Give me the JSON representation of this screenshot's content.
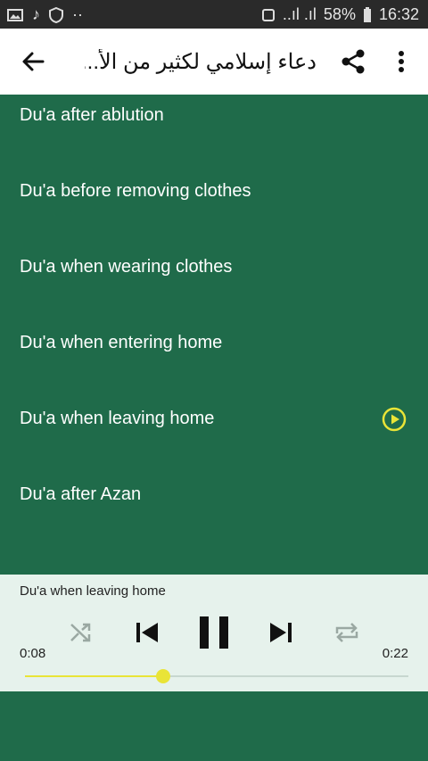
{
  "status_bar": {
    "battery": "58%",
    "time": "16:32",
    "signal": "..ıl .ıl"
  },
  "app_bar": {
    "title": "دعاء إسلامي لكثير من الأ..."
  },
  "list": {
    "items": [
      {
        "label": "Du'a after ablution",
        "playing": false
      },
      {
        "label": "Du'a before removing clothes",
        "playing": false
      },
      {
        "label": "Du'a when wearing clothes",
        "playing": false
      },
      {
        "label": "Du'a when entering home",
        "playing": false
      },
      {
        "label": "Du'a when leaving home",
        "playing": true
      },
      {
        "label": "Du'a after Azan",
        "playing": false
      }
    ]
  },
  "player": {
    "now_playing": "Du'a when leaving home",
    "elapsed": "0:08",
    "duration": "0:22",
    "progress": 0.36
  },
  "colors": {
    "list_bg": "#1f6b4a",
    "accent": "#e9e437",
    "player_bg": "#e6f2ec",
    "appbar_bg": "#ffffff"
  },
  "icons": [
    "back-arrow-icon",
    "share-icon",
    "more-vert-icon",
    "play-circle-icon",
    "shuffle-icon",
    "skip-previous-icon",
    "pause-icon",
    "skip-next-icon",
    "repeat-icon"
  ]
}
